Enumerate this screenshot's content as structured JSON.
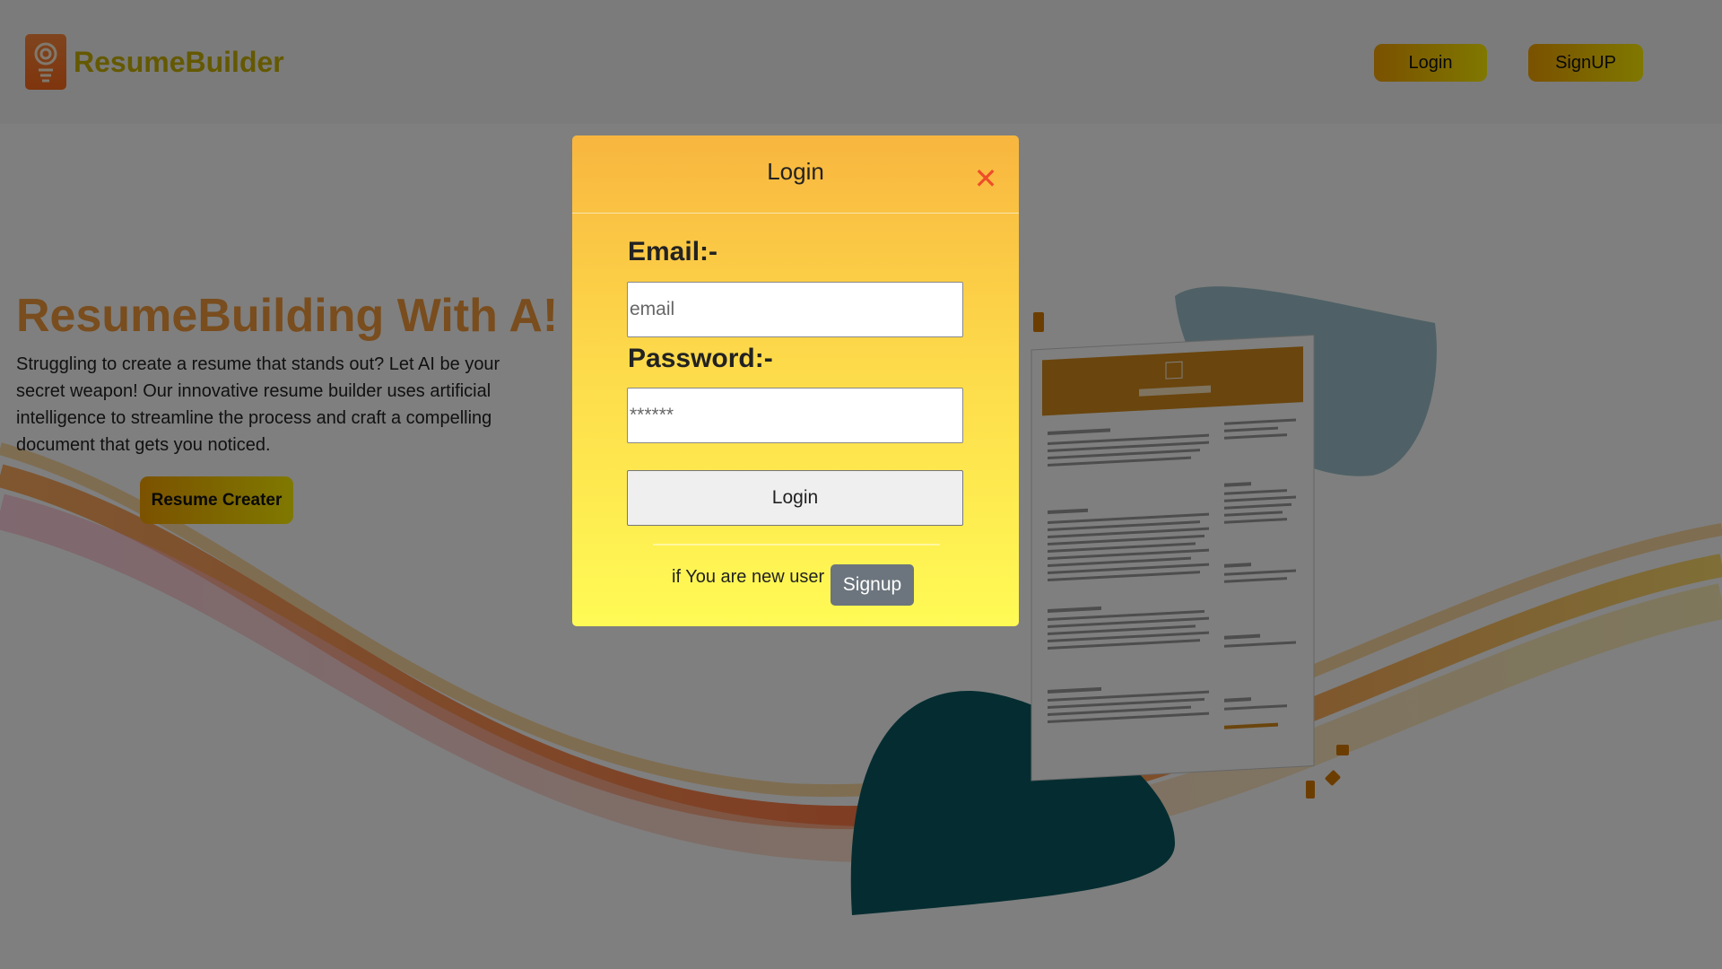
{
  "navbar": {
    "brand": "ResumeBuilder",
    "login_label": "Login",
    "signup_label": "SignUP"
  },
  "hero": {
    "title": "ResumeBuilding With A!",
    "description": "Struggling to create a resume that stands out? Let AI be your secret weapon! Our innovative resume builder uses artificial intelligence to streamline the process and craft a compelling document that gets you noticed.",
    "cta_label": "Resume Creater"
  },
  "modal": {
    "title": "Login",
    "close_glyph": "✕",
    "email_label": "Email:-",
    "email_placeholder": "email",
    "password_label": "Password:-",
    "password_placeholder": "******",
    "submit_label": "Login",
    "new_user_text": "if You are new user",
    "signup_label": "Signup"
  },
  "colors": {
    "accent_gradient_start": "#f5a300",
    "accent_gradient_end": "#fff000",
    "brand_text": "#c9b200",
    "hero_title": "#f29a3c",
    "close": "#ee4d2a",
    "signup_button": "#6c757d"
  }
}
